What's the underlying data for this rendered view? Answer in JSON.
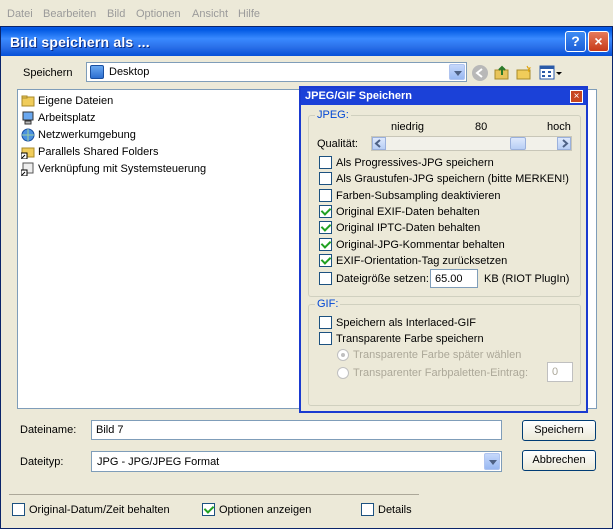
{
  "menu": [
    "Datei",
    "Bearbeiten",
    "Bild",
    "Optionen",
    "Ansicht",
    "Hilfe"
  ],
  "dialog": {
    "title": "Bild speichern als ...",
    "help_glyph": "?",
    "close_glyph": "×"
  },
  "location": {
    "label": "Speichern",
    "value": "Desktop"
  },
  "files": [
    {
      "name": "Eigene Dateien",
      "icon": "folder-icon"
    },
    {
      "name": "Arbeitsplatz",
      "icon": "computer-icon"
    },
    {
      "name": "Netzwerkumgebung",
      "icon": "network-icon"
    },
    {
      "name": "Parallels Shared Folders",
      "icon": "shortcut-folder-icon"
    },
    {
      "name": "Verknüpfung mit Systemsteuerung",
      "icon": "shortcut-icon"
    }
  ],
  "filename": {
    "label": "Dateiname:",
    "value": "Bild 7"
  },
  "filetype": {
    "label": "Dateityp:",
    "value": "JPG - JPG/JPEG Format"
  },
  "buttons": {
    "save": "Speichern",
    "cancel": "Abbrechen"
  },
  "bottom_options": [
    {
      "label": "Original-Datum/Zeit behalten",
      "checked": false
    },
    {
      "label": "Optionen anzeigen",
      "checked": true
    },
    {
      "label": "Details",
      "checked": false
    }
  ],
  "popup": {
    "title": "JPEG/GIF Speichern",
    "close_glyph": "×",
    "jpeg_group": "JPEG:",
    "quality": {
      "label": "Qualität:",
      "low": "niedrig",
      "value": "80",
      "high": "hoch",
      "level": 0.8
    },
    "jpeg_options": [
      {
        "label": "Als Progressives-JPG speichern",
        "checked": false
      },
      {
        "label": "Als Graustufen-JPG speichern (bitte MERKEN!)",
        "checked": false
      },
      {
        "label": "Farben-Subsampling deaktivieren",
        "checked": false
      },
      {
        "label": "Original EXIF-Daten behalten",
        "checked": true
      },
      {
        "label": "Original IPTC-Daten behalten",
        "checked": true
      },
      {
        "label": "Original-JPG-Kommentar behalten",
        "checked": true
      },
      {
        "label": "EXIF-Orientation-Tag zurücksetzen",
        "checked": true
      }
    ],
    "filesize": {
      "label": "Dateigröße setzen:",
      "value": "65.00",
      "suffix": "KB (RIOT PlugIn)",
      "checked": false
    },
    "gif_group": "GIF:",
    "gif_options": [
      {
        "label": "Speichern als Interlaced-GIF",
        "checked": false
      },
      {
        "label": "Transparente Farbe speichern",
        "checked": false
      }
    ],
    "gif_radios": [
      {
        "label": "Transparente Farbe später wählen",
        "selected": true
      },
      {
        "label": "Transparenter Farbpaletten-Eintrag:",
        "selected": false
      }
    ],
    "palette_value": "0"
  }
}
